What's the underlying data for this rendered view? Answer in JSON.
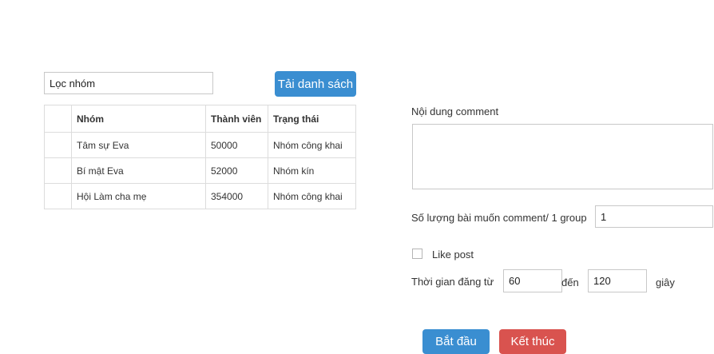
{
  "filter": {
    "value": "Lọc nhóm"
  },
  "load_button": {
    "label": "Tải danh sách"
  },
  "table": {
    "headers": {
      "name": "Nhóm",
      "members": "Thành viên",
      "status": "Trạng thái"
    },
    "rows": [
      {
        "name": "Tâm sự Eva",
        "members": "50000",
        "status": "Nhóm công khai"
      },
      {
        "name": "Bí mật Eva",
        "members": "52000",
        "status": "Nhóm kín"
      },
      {
        "name": "Hội Làm cha mẹ",
        "members": "354000",
        "status": "Nhóm công khai"
      }
    ]
  },
  "comment": {
    "label": "Nội dung comment",
    "value": ""
  },
  "count": {
    "label": "Số lượng bài muốn comment/ 1 group",
    "value": "1"
  },
  "like": {
    "label": "Like post",
    "checked": false
  },
  "timing": {
    "label": "Thời gian đăng từ",
    "from": "60",
    "to_label": "đến",
    "to": "120",
    "unit": "giây"
  },
  "actions": {
    "start": "Bắt đầu",
    "stop": "Kết thúc"
  },
  "colors": {
    "primary": "#3a8ed1",
    "danger": "#d9534f"
  }
}
